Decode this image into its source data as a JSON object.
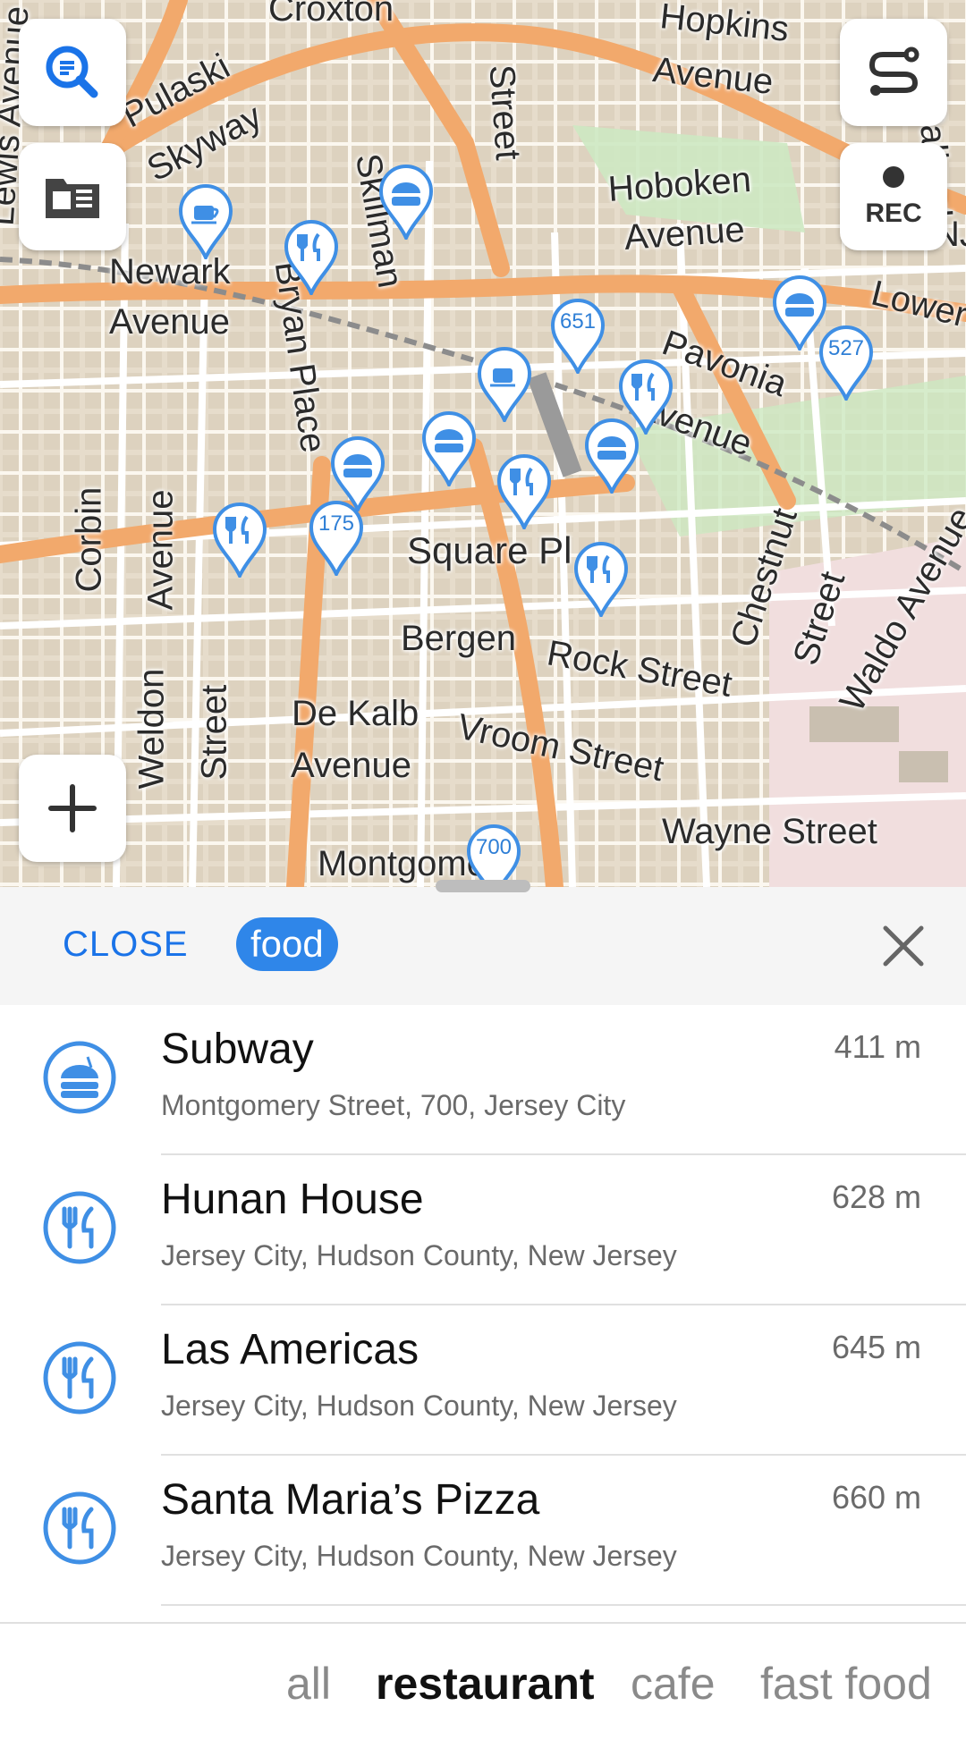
{
  "map": {
    "street_labels": [
      "Croxton",
      "Hopkins",
      "Avenue",
      "Pulaski",
      "Skyway",
      "Hoboken",
      "Avenue",
      "Newark",
      "Avenue",
      "Lower",
      "Pavonia",
      "Avenue",
      "Square Pl",
      "Corbin",
      "Avenue",
      "Bryan Place",
      "Bergen",
      "Rock Street",
      "De Kalb",
      "Avenue",
      "Vroom Street",
      "Wayne Street",
      "Montgomery",
      "Weldon",
      "Street",
      "Chestnut",
      "Street",
      "Waldo Avenue",
      "Lewis Avenue",
      "NJ",
      "Street",
      "Skillman",
      "Palisad"
    ],
    "pin_numbers": [
      "651",
      "527",
      "175",
      "700"
    ],
    "buttons": {
      "search_icon": "search-icon",
      "layers_icon": "map-layers-icon",
      "route_icon": "route-icon",
      "rec_label": "REC",
      "zoom_in_icon": "plus-icon"
    }
  },
  "panel": {
    "close_label": "CLOSE",
    "query_chip": "food",
    "results": [
      {
        "title": "Subway",
        "subtitle": "Montgomery Street, 700, Jersey City",
        "distance": "411 m",
        "icon": "fast-food-icon"
      },
      {
        "title": "Hunan House",
        "subtitle": "Jersey City, Hudson County, New Jersey",
        "distance": "628 m",
        "icon": "restaurant-icon"
      },
      {
        "title": "Las Americas",
        "subtitle": "Jersey City, Hudson County, New Jersey",
        "distance": "645 m",
        "icon": "restaurant-icon"
      },
      {
        "title": "Santa Maria’s Pizza",
        "subtitle": "Jersey City, Hudson County, New Jersey",
        "distance": "660 m",
        "icon": "restaurant-icon"
      }
    ],
    "filters": [
      {
        "label": "all",
        "active": false
      },
      {
        "label": "restaurant",
        "active": true
      },
      {
        "label": "cafe",
        "active": false
      },
      {
        "label": "fast food",
        "active": false
      }
    ]
  },
  "colors": {
    "accent": "#2f86e9",
    "map_background": "#efe7d8",
    "major_road": "#f2a96c",
    "park": "#cde8c2"
  }
}
